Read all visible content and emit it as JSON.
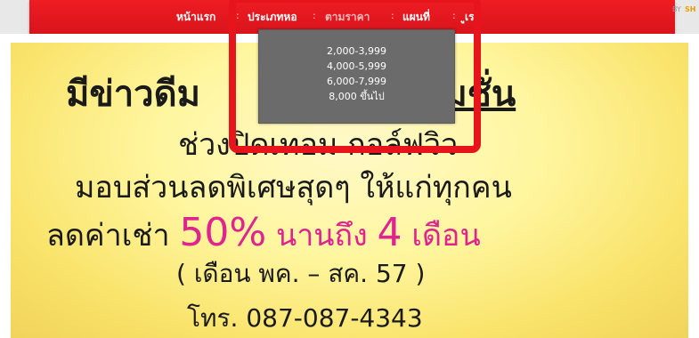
{
  "nav": {
    "items": [
      {
        "label": "หน้าแรก"
      },
      {
        "label": "ประเภทหอ"
      },
      {
        "label": "ตามราคา"
      },
      {
        "label": "แผนที่"
      },
      {
        "label": "ูเรา"
      }
    ],
    "separator": ":"
  },
  "corner": {
    "by": "BY",
    "brand": "SH"
  },
  "dropdown": {
    "options": [
      "2,000-3,999",
      "4,000-5,999",
      "6,000-7,999",
      "8,000 ขึ้นไป"
    ]
  },
  "poster": {
    "line1_a": "มีข่าวดีม",
    "line1_b": "ปรโมชั่น",
    "line2": "ช่วงปิดเทอม  กอล์ฟวิว",
    "line3": "มอบส่วนลดพิเศษสุดๆ ให้แก่ทุกคน",
    "line4_prefix": "ลดค่าเช่า ",
    "line4_percent": "50%",
    "line4_mid": " นานถึง ",
    "line4_num": "4",
    "line4_suffix": " เดือน",
    "line5": "( เดือน พค. – สค. 57 )",
    "line6": "โทร. 087-087-4343"
  },
  "colors": {
    "nav_red": "#e8141c",
    "highlight": "#e8141c",
    "promo_pink": "#e0248f",
    "dropdown_bg": "#6b6b6b"
  }
}
